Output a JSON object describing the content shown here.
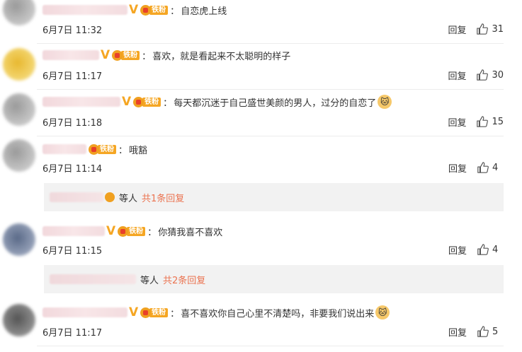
{
  "comments": [
    {
      "badge": "铁粉",
      "text": "自恋虎上线",
      "date": "6月7日 11:32",
      "reply": "回复",
      "likes": "31"
    },
    {
      "badge": "铁粉",
      "text": "喜欢，就是看起来不太聪明的样子",
      "date": "6月7日 11:17",
      "reply": "回复",
      "likes": "30"
    },
    {
      "badge": "铁粉",
      "text": "每天都沉迷于自己盛世美颜的男人，过分的自恋了",
      "date": "6月7日 11:18",
      "reply": "回复",
      "likes": "15"
    },
    {
      "badge": "铁粉",
      "text": "哦豁",
      "date": "6月7日 11:14",
      "reply": "回复",
      "likes": "4"
    },
    {
      "badge": "铁粉",
      "text": "你猜我喜不喜欢",
      "date": "6月7日 11:15",
      "reply": "回复",
      "likes": "4"
    },
    {
      "badge": "铁粉",
      "text": "喜不喜欢你自己心里不清楚吗，非要我们说出来",
      "date": "6月7日 11:17",
      "reply": "回复",
      "likes": "5"
    }
  ],
  "subreplies": [
    {
      "who": "等人",
      "more": "共1条回复"
    },
    {
      "who": "等人",
      "more": "共2条回复"
    }
  ],
  "icons": {
    "like": "thumbs-up-icon",
    "vip": "v-badge-icon",
    "emoji": "cat-face-emoji"
  },
  "colors": {
    "accent": "#eb7350",
    "vip": "#f5a623",
    "subreply_bg": "#f2f2f2"
  }
}
